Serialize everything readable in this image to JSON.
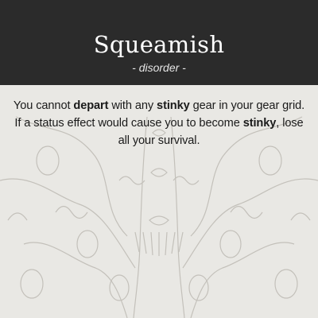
{
  "card": {
    "title": "Squeamish",
    "subtitle": "- disorder -",
    "description": [
      {
        "text": "You cannot ",
        "bold": false
      },
      {
        "text": "depart",
        "bold": true
      },
      {
        "text": " with any ",
        "bold": false
      },
      {
        "text": "stinky",
        "bold": true
      },
      {
        "text": " gear in your gear grid. If a status effect would cause you to become ",
        "bold": false
      },
      {
        "text": "stinky",
        "bold": true
      },
      {
        "text": ", lose all your survival.",
        "bold": false
      }
    ]
  },
  "colors": {
    "header": "#2b2b2b",
    "background": "#e9e8e4",
    "title": "#ffffff",
    "text": "#1a1a1a"
  }
}
